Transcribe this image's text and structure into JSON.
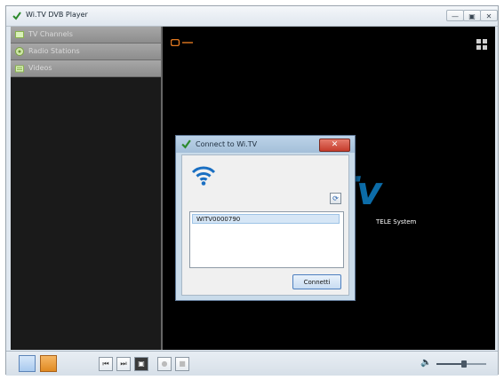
{
  "window": {
    "title": "Wi.TV DVB Player",
    "minimize": "—",
    "maximize": "▣",
    "close": "✕"
  },
  "sidebar": {
    "items": [
      {
        "label": "TV Channels",
        "icon": "tv-icon"
      },
      {
        "label": "Radio Stations",
        "icon": "radio-icon"
      },
      {
        "label": "Videos",
        "icon": "video-folder-icon"
      }
    ]
  },
  "video": {
    "logo_text": "Tv",
    "brand_text": "TELE System"
  },
  "dialog": {
    "title": "Connect to Wi.TV",
    "close": "✕",
    "refresh": "⟳",
    "devices": [
      "WITV0000790"
    ],
    "connect_label": "Connetti"
  },
  "toolbar": {
    "prev": "⏮",
    "next": "⏭",
    "snapshot": "▣",
    "record": "●",
    "stop": "■",
    "volume_icon": "🔈",
    "volume_level": 0.55
  },
  "colors": {
    "accent": "#0c6ca8",
    "dialog_title": "#a4bfd9",
    "close_red": "#c53c2c",
    "wifi_blue": "#1a6fc2"
  }
}
